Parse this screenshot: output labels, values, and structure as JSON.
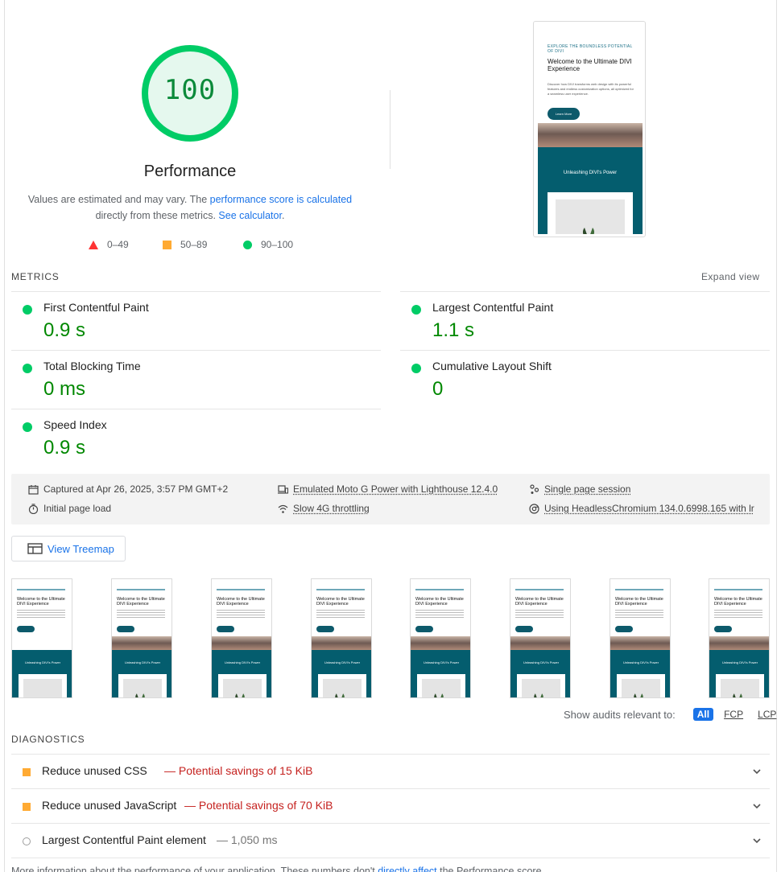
{
  "score": {
    "value": "100",
    "title": "Performance"
  },
  "description": {
    "prefix": "Values are estimated and may vary. The ",
    "link1": "performance score is calculated",
    "middle": "directly from these metrics. ",
    "link2": "See calculator",
    "suffix": "."
  },
  "legend": {
    "fail": "0–49",
    "average": "50–89",
    "pass": "90–100"
  },
  "screenshot": {
    "eyebrow": "EXPLORE THE BOUNDLESS POTENTIAL OF DIVI",
    "title": "Welcome to the Ultimate DIVI Experience",
    "body": "Discover how DIVI transforms web design with its powerful features and endless customization options, all optimized for a seamless user experience.",
    "button": "Learn More",
    "section": "Unleashing DIVI's Power"
  },
  "metrics": {
    "label": "METRICS",
    "expand": "Expand view",
    "fcp": {
      "name": "First Contentful Paint",
      "value": "0.9 s"
    },
    "lcp": {
      "name": "Largest Contentful Paint",
      "value": "1.1 s"
    },
    "tbt": {
      "name": "Total Blocking Time",
      "value": "0 ms"
    },
    "cls": {
      "name": "Cumulative Layout Shift",
      "value": "0"
    },
    "si": {
      "name": "Speed Index",
      "value": "0.9 s"
    }
  },
  "runtime": {
    "captured": "Captured at Apr 26, 2025, 3:57 PM GMT+2",
    "initial": "Initial page load",
    "device": "Emulated Moto G Power with Lighthouse 12.4.0",
    "network": "Slow 4G throttling",
    "session": "Single page session",
    "browser": "Using HeadlessChromium 134.0.6998.165 with lr"
  },
  "treemap": {
    "label": "View Treemap"
  },
  "filmstrip": {
    "title": "Welcome to the Ultimate DIVI Experience",
    "section": "Unleashing DIVI's Power"
  },
  "filter": {
    "label": "Show audits relevant to:",
    "all": "All",
    "fcp": "FCP",
    "lcp": "LCP"
  },
  "diagnostics": {
    "label": "DIAGNOSTICS",
    "items": [
      {
        "title": "Reduce unused CSS",
        "savings": "— Potential savings of 15 KiB"
      },
      {
        "title": "Reduce unused JavaScript",
        "savings": "— Potential savings of 70 KiB"
      },
      {
        "title": "Largest Contentful Paint element",
        "savings": "— 1,050 ms"
      }
    ]
  },
  "footnote": {
    "prefix": "More information about the performance of your application. These numbers don't ",
    "link": "directly affect",
    "suffix": " the Performance score."
  },
  "colors": {
    "pass": "#00cc66",
    "average": "#ffaa33",
    "fail": "#ff3333",
    "link": "#1a73e8",
    "savings": "#c5221f"
  }
}
